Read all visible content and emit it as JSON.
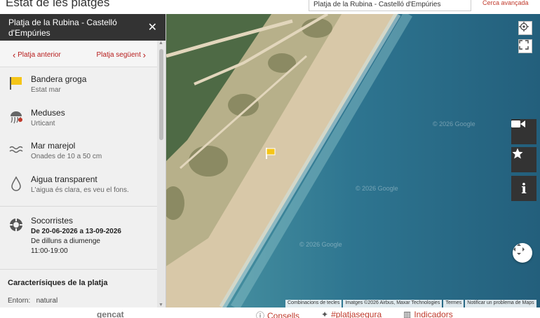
{
  "header": {
    "title": "Estat de les platges",
    "search_value": "Platja de la Rubina - Castelló d'Empúries",
    "advanced_search": "Cerca avançada"
  },
  "panel": {
    "title": "Platja de la Rubina - Castelló d'Empúries",
    "prev": "Platja anterior",
    "next": "Platja següent",
    "flag": {
      "title": "Bandera groga",
      "sub": "Estat mar"
    },
    "jellyfish": {
      "title": "Meduses",
      "sub": "Urticant"
    },
    "sea": {
      "title": "Mar marejol",
      "sub": "Onades de 10 a 50 cm"
    },
    "water": {
      "title": "Aigua transparent",
      "sub": "L'aigua és clara, es veu el fons."
    },
    "lifeguards": {
      "title": "Socorristes",
      "dates": "De 20-06-2026 a 13-09-2026",
      "days": "De dilluns a diumenge",
      "hours": "11:00-19:00"
    },
    "features_title": "Caracterísiques de la platja",
    "entorn_label": "Entorn:",
    "entorn_value": "natural"
  },
  "map": {
    "footer": {
      "shortcuts": "Combinacions de tecles",
      "imagery": "Imatges ©2026 Airbus, Maxar Technologies",
      "terms": "Termes",
      "report": "Notificar un problema de Maps"
    },
    "watermarks": [
      "© 2026 Google",
      "© 2026 Google",
      "© 2026 Google"
    ]
  },
  "footer": {
    "logo": "gencat",
    "consells": "Consells",
    "hashtag": "#platjasegura",
    "indicadors": "Indicadors"
  },
  "colors": {
    "accent": "#c0392b",
    "flag": "#f5c518",
    "panel_header": "#333333"
  }
}
